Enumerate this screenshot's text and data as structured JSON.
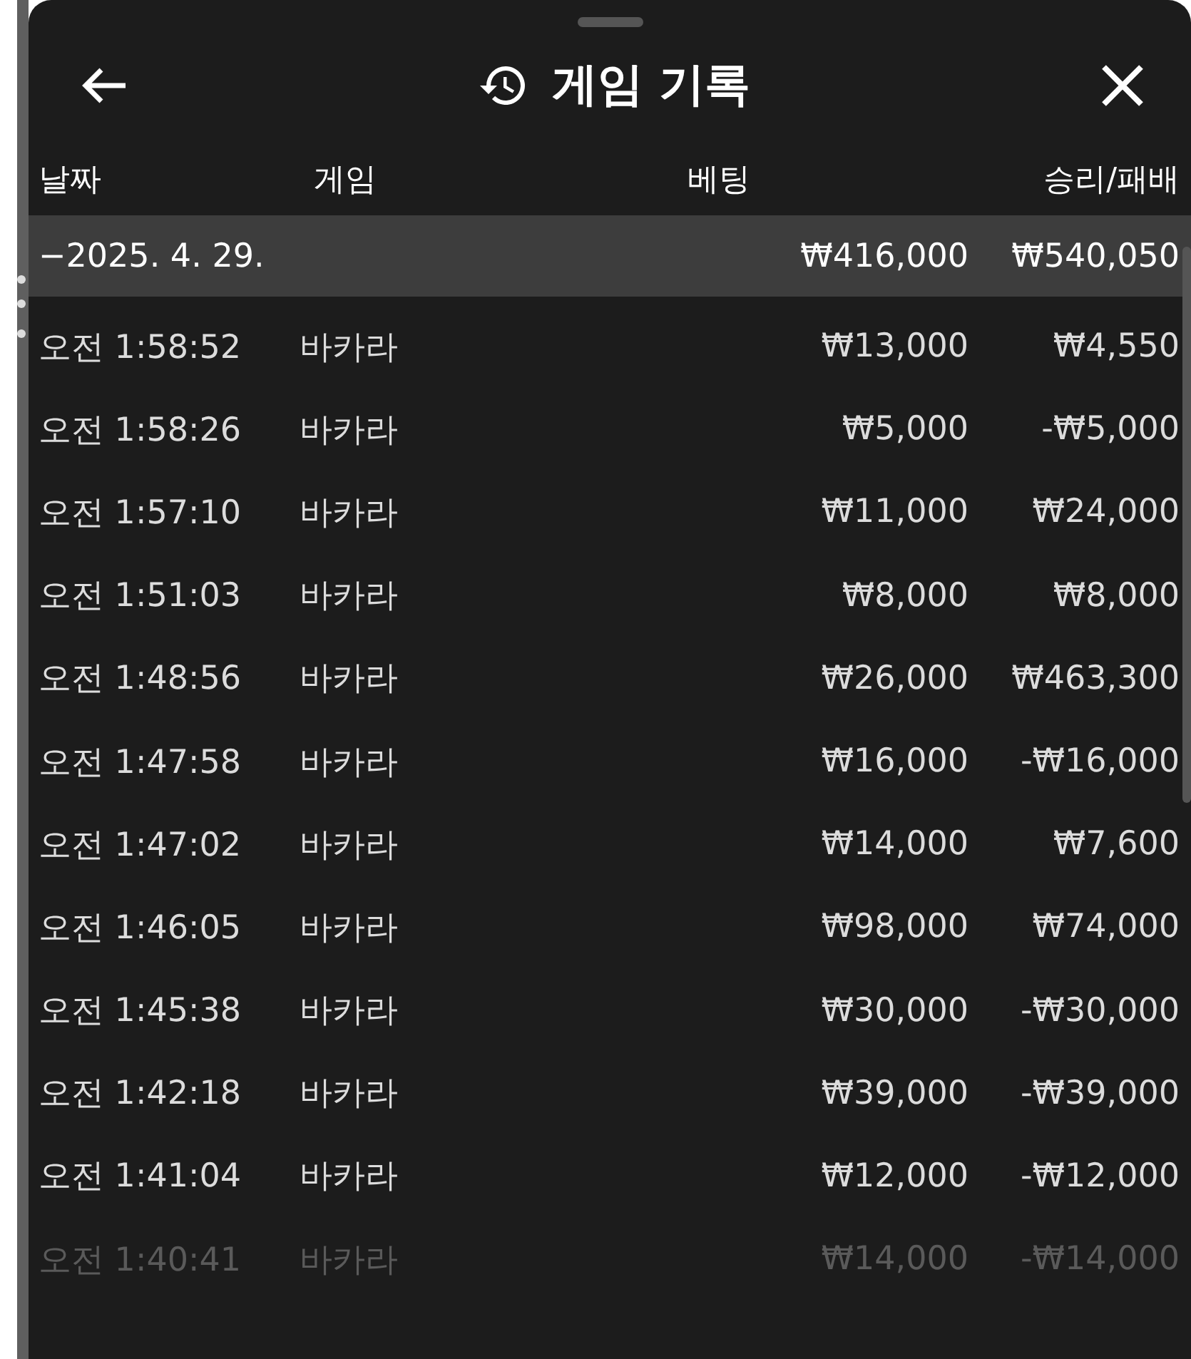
{
  "header": {
    "title": "게임 기록"
  },
  "table": {
    "columns": [
      "날짜",
      "게임",
      "베팅",
      "승리/패배"
    ],
    "group": {
      "toggle": "−",
      "date": "2025. 4. 29.",
      "bet": "₩416,000",
      "result": "₩540,050"
    },
    "rows": [
      {
        "time": "오전 1:58:52",
        "game": "바카라",
        "bet": "₩13,000",
        "result": "₩4,550",
        "dimmed": false
      },
      {
        "time": "오전 1:58:26",
        "game": "바카라",
        "bet": "₩5,000",
        "result": "-₩5,000",
        "dimmed": false
      },
      {
        "time": "오전 1:57:10",
        "game": "바카라",
        "bet": "₩11,000",
        "result": "₩24,000",
        "dimmed": false
      },
      {
        "time": "오전 1:51:03",
        "game": "바카라",
        "bet": "₩8,000",
        "result": "₩8,000",
        "dimmed": false
      },
      {
        "time": "오전 1:48:56",
        "game": "바카라",
        "bet": "₩26,000",
        "result": "₩463,300",
        "dimmed": false
      },
      {
        "time": "오전 1:47:58",
        "game": "바카라",
        "bet": "₩16,000",
        "result": "-₩16,000",
        "dimmed": false
      },
      {
        "time": "오전 1:47:02",
        "game": "바카라",
        "bet": "₩14,000",
        "result": "₩7,600",
        "dimmed": false
      },
      {
        "time": "오전 1:46:05",
        "game": "바카라",
        "bet": "₩98,000",
        "result": "₩74,000",
        "dimmed": false
      },
      {
        "time": "오전 1:45:38",
        "game": "바카라",
        "bet": "₩30,000",
        "result": "-₩30,000",
        "dimmed": false
      },
      {
        "time": "오전 1:42:18",
        "game": "바카라",
        "bet": "₩39,000",
        "result": "-₩39,000",
        "dimmed": false
      },
      {
        "time": "오전 1:41:04",
        "game": "바카라",
        "bet": "₩12,000",
        "result": "-₩12,000",
        "dimmed": false
      },
      {
        "time": "오전 1:40:41",
        "game": "바카라",
        "bet": "₩14,000",
        "result": "-₩14,000",
        "dimmed": true
      }
    ]
  }
}
